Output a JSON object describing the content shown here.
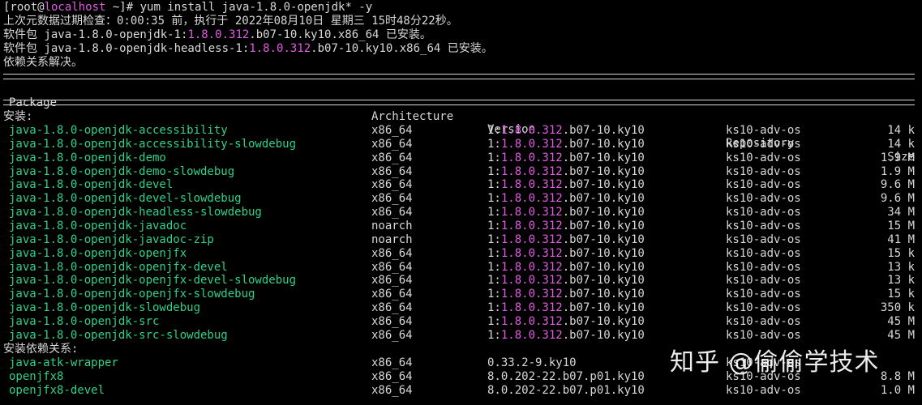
{
  "prompt": {
    "open": "[root@",
    "host": "localhost",
    "rest": " ~]# yum install java-1.8.0-openjdk* -y"
  },
  "intro": {
    "line1": "上次元数据过期检查：0:00:35 前，执行于 2022年08月10日 星期三 15时48分22秒。",
    "installed": [
      {
        "pre": "软件包 java-1.8.0-openjdk-1:",
        "ver": "1.8.0.312",
        "post": ".b07-10.ky10.x86_64 已安装。"
      },
      {
        "pre": "软件包 java-1.8.0-openjdk-headless-1:",
        "ver": "1.8.0.312",
        "post": ".b07-10.ky10.x86_64 已安装。"
      }
    ],
    "resolved": "依赖关系解决。"
  },
  "table": {
    "headers": {
      "package": "Package",
      "architecture": "Architecture",
      "version": "Version",
      "repository": "Repository",
      "size": "Size"
    },
    "section_install": "安装:",
    "section_deps": "安装依赖关系:",
    "install_rows": [
      {
        "pkg": "java-1.8.0-openjdk-accessibility",
        "arch": "x86_64",
        "epoch": "1:",
        "ver": "1.8.0.312",
        "rel": ".b07-10.ky10",
        "repo": "ks10-adv-os",
        "size": "14 k"
      },
      {
        "pkg": "java-1.8.0-openjdk-accessibility-slowdebug",
        "arch": "x86_64",
        "epoch": "1:",
        "ver": "1.8.0.312",
        "rel": ".b07-10.ky10",
        "repo": "ks10-adv-os",
        "size": "14 k"
      },
      {
        "pkg": "java-1.8.0-openjdk-demo",
        "arch": "x86_64",
        "epoch": "1:",
        "ver": "1.8.0.312",
        "rel": ".b07-10.ky10",
        "repo": "ks10-adv-os",
        "size": "1.9 M"
      },
      {
        "pkg": "java-1.8.0-openjdk-demo-slowdebug",
        "arch": "x86_64",
        "epoch": "1:",
        "ver": "1.8.0.312",
        "rel": ".b07-10.ky10",
        "repo": "ks10-adv-os",
        "size": "1.9 M"
      },
      {
        "pkg": "java-1.8.0-openjdk-devel",
        "arch": "x86_64",
        "epoch": "1:",
        "ver": "1.8.0.312",
        "rel": ".b07-10.ky10",
        "repo": "ks10-adv-os",
        "size": "9.6 M"
      },
      {
        "pkg": "java-1.8.0-openjdk-devel-slowdebug",
        "arch": "x86_64",
        "epoch": "1:",
        "ver": "1.8.0.312",
        "rel": ".b07-10.ky10",
        "repo": "ks10-adv-os",
        "size": "9.6 M"
      },
      {
        "pkg": "java-1.8.0-openjdk-headless-slowdebug",
        "arch": "x86_64",
        "epoch": "1:",
        "ver": "1.8.0.312",
        "rel": ".b07-10.ky10",
        "repo": "ks10-adv-os",
        "size": "34 M"
      },
      {
        "pkg": "java-1.8.0-openjdk-javadoc",
        "arch": "noarch",
        "epoch": "1:",
        "ver": "1.8.0.312",
        "rel": ".b07-10.ky10",
        "repo": "ks10-adv-os",
        "size": "15 M"
      },
      {
        "pkg": "java-1.8.0-openjdk-javadoc-zip",
        "arch": "noarch",
        "epoch": "1:",
        "ver": "1.8.0.312",
        "rel": ".b07-10.ky10",
        "repo": "ks10-adv-os",
        "size": "41 M"
      },
      {
        "pkg": "java-1.8.0-openjdk-openjfx",
        "arch": "x86_64",
        "epoch": "1:",
        "ver": "1.8.0.312",
        "rel": ".b07-10.ky10",
        "repo": "ks10-adv-os",
        "size": "15 k"
      },
      {
        "pkg": "java-1.8.0-openjdk-openjfx-devel",
        "arch": "x86_64",
        "epoch": "1:",
        "ver": "1.8.0.312",
        "rel": ".b07-10.ky10",
        "repo": "ks10-adv-os",
        "size": "13 k"
      },
      {
        "pkg": "java-1.8.0-openjdk-openjfx-devel-slowdebug",
        "arch": "x86_64",
        "epoch": "1:",
        "ver": "1.8.0.312",
        "rel": ".b07-10.ky10",
        "repo": "ks10-adv-os",
        "size": "13 k"
      },
      {
        "pkg": "java-1.8.0-openjdk-openjfx-slowdebug",
        "arch": "x86_64",
        "epoch": "1:",
        "ver": "1.8.0.312",
        "rel": ".b07-10.ky10",
        "repo": "ks10-adv-os",
        "size": "15 k"
      },
      {
        "pkg": "java-1.8.0-openjdk-slowdebug",
        "arch": "x86_64",
        "epoch": "1:",
        "ver": "1.8.0.312",
        "rel": ".b07-10.ky10",
        "repo": "ks10-adv-os",
        "size": "350 k"
      },
      {
        "pkg": "java-1.8.0-openjdk-src",
        "arch": "x86_64",
        "epoch": "1:",
        "ver": "1.8.0.312",
        "rel": ".b07-10.ky10",
        "repo": "ks10-adv-os",
        "size": "45 M"
      },
      {
        "pkg": "java-1.8.0-openjdk-src-slowdebug",
        "arch": "x86_64",
        "epoch": "1:",
        "ver": "1.8.0.312",
        "rel": ".b07-10.ky10",
        "repo": "ks10-adv-os",
        "size": "45 M"
      }
    ],
    "dep_rows": [
      {
        "pkg": "java-atk-wrapper",
        "arch": "x86_64",
        "version": "0.33.2-9.ky10",
        "repo": "ks10-adv-os",
        "size": ""
      },
      {
        "pkg": "openjfx8",
        "arch": "x86_64",
        "version": "8.0.202-22.b07.p01.ky10",
        "repo": "ks10-adv-os",
        "size": "8.8 M"
      },
      {
        "pkg": "openjfx8-devel",
        "arch": "x86_64",
        "version": "8.0.202-22.b07.p01.ky10",
        "repo": "ks10-adv-os",
        "size": "1.0 M"
      }
    ]
  },
  "watermark": "知乎 @偷偷学技术",
  "colors": {
    "background": "#000000",
    "text": "#d8d8d8",
    "package": "#2fd189",
    "version": "#e05ce0"
  }
}
